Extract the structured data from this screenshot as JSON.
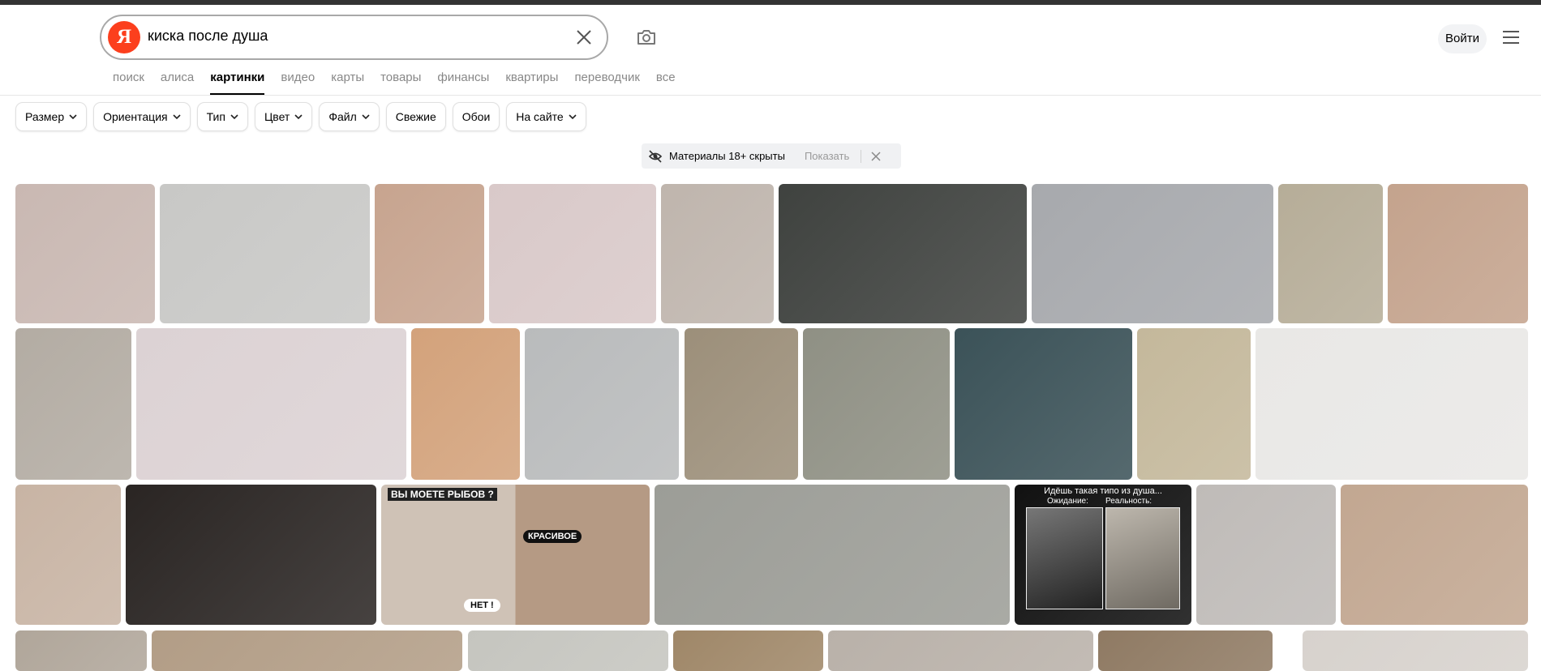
{
  "search": {
    "logo_letter": "Я",
    "query": "киска после душа"
  },
  "header": {
    "login_label": "Войти"
  },
  "nav": [
    "поиск",
    "алиса",
    "картинки",
    "видео",
    "карты",
    "товары",
    "финансы",
    "квартиры",
    "переводчик",
    "все"
  ],
  "nav_active": "картинки",
  "filters": [
    {
      "label": "Размер",
      "dropdown": true
    },
    {
      "label": "Ориентация",
      "dropdown": true
    },
    {
      "label": "Тип",
      "dropdown": true
    },
    {
      "label": "Цвет",
      "dropdown": true
    },
    {
      "label": "Файл",
      "dropdown": true
    },
    {
      "label": "Свежие",
      "dropdown": false
    },
    {
      "label": "Обои",
      "dropdown": false
    },
    {
      "label": "На сайте",
      "dropdown": true
    }
  ],
  "notice": {
    "text": "Материалы 18+ скрыты",
    "show_label": "Показать"
  },
  "images": [
    {
      "row": 1,
      "color": "#c9b8b2",
      "caption": ""
    },
    {
      "row": 1,
      "color": "#c8c8c6",
      "caption": ""
    },
    {
      "row": 1,
      "color": "#c7a48f",
      "caption": ""
    },
    {
      "row": 1,
      "color": "#d9c9c9",
      "caption": ""
    },
    {
      "row": 1,
      "color": "#bfb5ad",
      "caption": ""
    },
    {
      "row": 1,
      "color": "#3f423f",
      "caption": ""
    },
    {
      "row": 1,
      "color": "#a7a9ad",
      "caption": ""
    },
    {
      "row": 1,
      "color": "#b6ad98",
      "caption": ""
    },
    {
      "row": 1,
      "color": "#c4a38d",
      "caption": ""
    },
    {
      "row": 2,
      "color": "#b3aca3",
      "caption": ""
    },
    {
      "row": 2,
      "color": "#dcd2d4",
      "caption": ""
    },
    {
      "row": 2,
      "color": "#d3a27b",
      "caption": ""
    },
    {
      "row": 2,
      "color": "#b9bbbc",
      "caption": ""
    },
    {
      "row": 2,
      "color": "#9c8f7a",
      "caption": ""
    },
    {
      "row": 2,
      "color": "#8f9084",
      "caption": ""
    },
    {
      "row": 2,
      "color": "#3b5258",
      "caption": ""
    },
    {
      "row": 2,
      "color": "#c4b89b",
      "caption": ""
    },
    {
      "row": 2,
      "color": "#e9e8e6",
      "caption": ""
    },
    {
      "row": 3,
      "color": "#c8b4a4",
      "caption": ""
    },
    {
      "row": 3,
      "color": "#2a2523",
      "caption": ""
    },
    {
      "row": 3,
      "color": "#c7b9ad",
      "caption": "ВЫ МОЕТЕ РЫБОВ ?"
    },
    {
      "row": 3,
      "color": "#b7a899",
      "caption": ""
    },
    {
      "row": 3,
      "color": "#9c9d97",
      "caption": ""
    },
    {
      "row": 3,
      "color": "#111111",
      "caption": "Идёшь такая типо из душа..."
    },
    {
      "row": 3,
      "color": "#bfbbb8",
      "caption": ""
    },
    {
      "row": 3,
      "color": "#c2a791",
      "caption": ""
    },
    {
      "row": 4,
      "color": "#b0a69a",
      "caption": ""
    },
    {
      "row": 4,
      "color": "#b29d86",
      "caption": ""
    },
    {
      "row": 4,
      "color": "#c5c5bf",
      "caption": ""
    },
    {
      "row": 4,
      "color": "#9f8768",
      "caption": ""
    },
    {
      "row": 4,
      "color": "#b9b1a9",
      "caption": ""
    },
    {
      "row": 4,
      "color": "#8f7a63",
      "caption": ""
    },
    {
      "row": 4,
      "color": "#d7d2cd",
      "caption": ""
    }
  ],
  "subcaptions": {
    "meme_top": "ВЫ МОЕТЕ РЫБОВ ?",
    "meme_mid": "КРАСИВОЕ",
    "meme_bottom": "НЕТ !",
    "mem2_left": "Ожидание:",
    "mem2_right": "Реальность:"
  }
}
